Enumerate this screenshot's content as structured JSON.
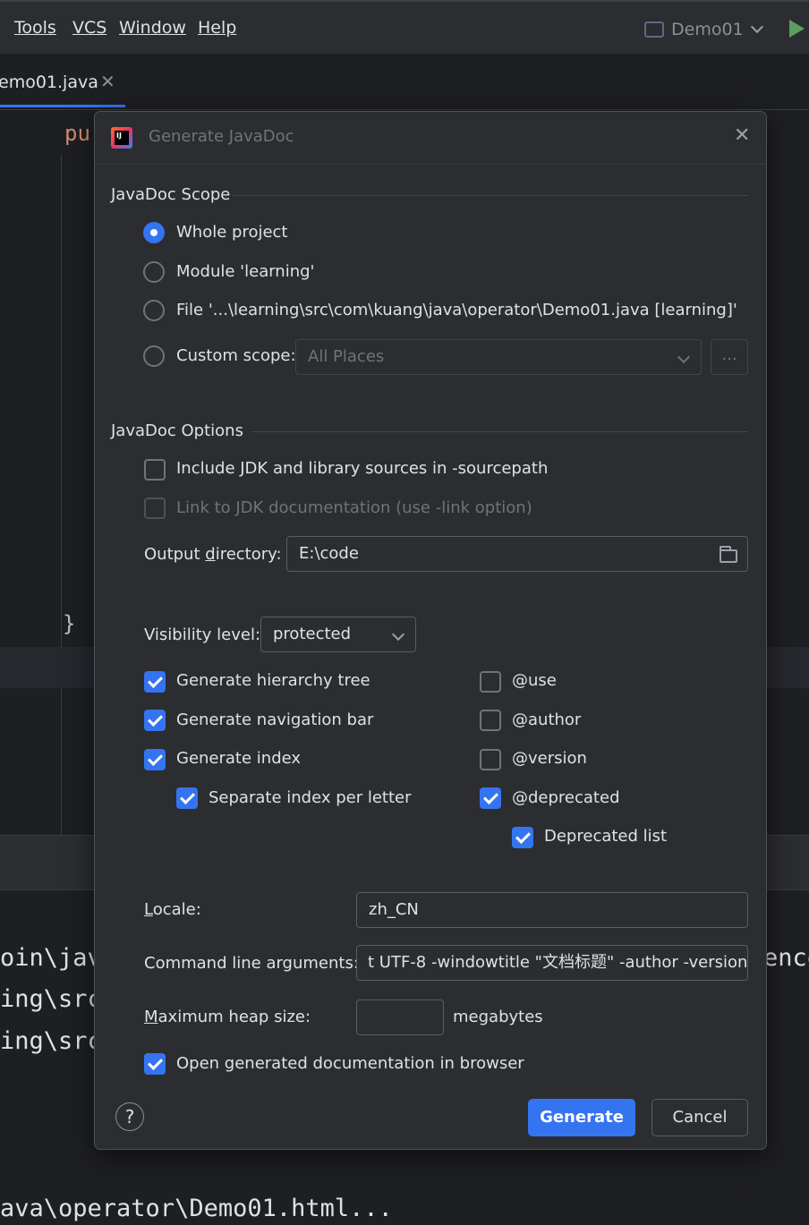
{
  "menubar": {
    "items": [
      {
        "label": "Tools"
      },
      {
        "label": "VCS"
      },
      {
        "label": "Window"
      },
      {
        "label": "Help"
      }
    ],
    "run_config": "Demo01"
  },
  "editor": {
    "tab_label": "emo01.java",
    "code_keyword": "pu",
    "code_brace": "}"
  },
  "console": {
    "lines": [
      "oin\\java",
      "ing\\src\\",
      "ing\\src\\",
      "ava\\operator\\Demo01.html..."
    ],
    "right_fragment": "enco"
  },
  "dialog": {
    "title": "Generate JavaDoc",
    "scope": {
      "title": "JavaDoc Scope",
      "options": [
        {
          "label": "Whole project",
          "checked": true
        },
        {
          "label": "Module 'learning'",
          "checked": false
        },
        {
          "label": "File '...\\learning\\src\\com\\kuang\\java\\operator\\Demo01.java [learning]'",
          "checked": false
        },
        {
          "label": "Custom scope:",
          "checked": false
        }
      ],
      "custom_scope_value": "All Places",
      "browse_label": "..."
    },
    "options": {
      "title": "JavaDoc Options",
      "include_jdk": {
        "label": "Include JDK and library sources in -sourcepath",
        "checked": false
      },
      "link_jdk": {
        "label": "Link to JDK documentation (use -link option)",
        "checked": false,
        "disabled": true
      },
      "output_dir": {
        "label_pre": "Output ",
        "label_u": "d",
        "label_post": "irectory:",
        "value": "E:\\code"
      },
      "visibility": {
        "label": "Visibility level:",
        "value": "protected"
      },
      "left_checks": [
        {
          "label": "Generate hierarchy tree",
          "checked": true
        },
        {
          "label": "Generate navigation bar",
          "checked": true
        },
        {
          "label": "Generate index",
          "checked": true
        },
        {
          "label": "Separate index per letter",
          "checked": true
        }
      ],
      "right_checks": [
        {
          "label": "@use",
          "checked": false
        },
        {
          "label": "@author",
          "checked": false
        },
        {
          "label": "@version",
          "checked": false
        },
        {
          "label": "@deprecated",
          "checked": true
        },
        {
          "label": "Deprecated list",
          "checked": true
        }
      ],
      "locale": {
        "label_u": "L",
        "label_post": "ocale:",
        "value": "zh_CN"
      },
      "cmd_args": {
        "label": "Command line arguments:",
        "value": "t UTF-8 -windowtitle \"文档标题\" -author -version"
      },
      "heap": {
        "label_u": "M",
        "label_post": "aximum heap size:",
        "value": "",
        "unit": "megabytes"
      },
      "open_browser": {
        "label": "Open generated documentation in browser",
        "checked": true
      }
    },
    "buttons": {
      "help": "?",
      "generate": "Generate",
      "cancel": "Cancel"
    }
  }
}
